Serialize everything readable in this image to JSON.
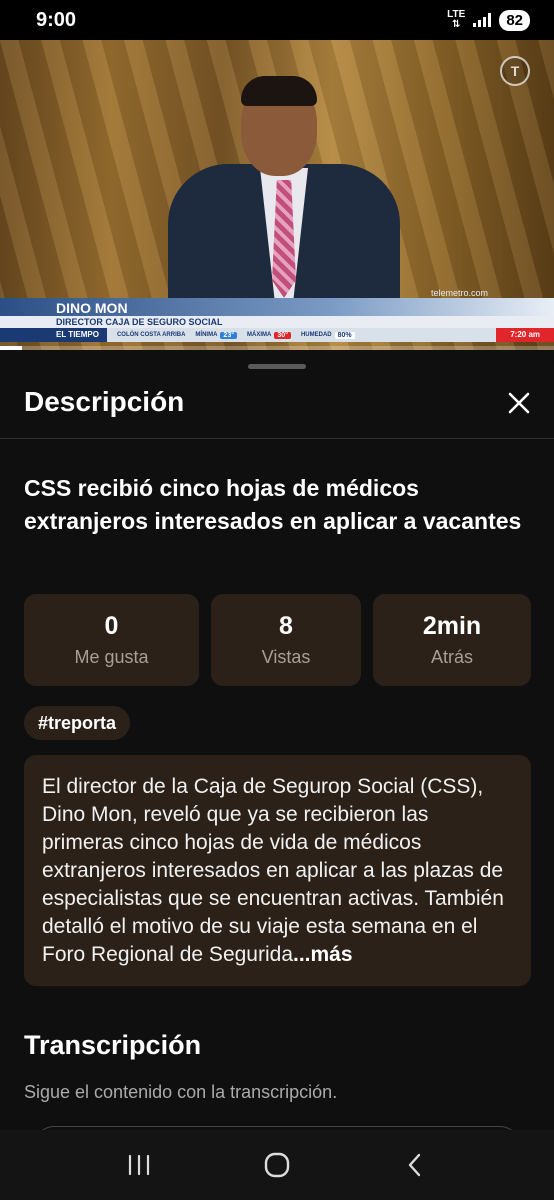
{
  "status_bar": {
    "time": "9:00",
    "network": "LTE",
    "battery": "82",
    "icons": [
      "lte-icon",
      "signal-icon",
      "battery-icon"
    ]
  },
  "video": {
    "channel_logo": "T",
    "watermark": "telemetro.com",
    "lower_third": {
      "name": "DINO MON",
      "title": "DIRECTOR CAJA DE SEGURO SOCIAL",
      "weather_label": "EL TIEMPO",
      "weather_location": "COLÓN COSTA ARRIBA",
      "minima_label": "MÍNIMA",
      "minima_value": "23°",
      "maxima_label": "MÁXIMA",
      "maxima_value": "30°",
      "humedad_label": "HUMEDAD",
      "humedad_value": "80%",
      "clock": "7:20 am"
    },
    "progress_fraction": 0.04
  },
  "sheet": {
    "title": "Descripción",
    "video_title": "CSS recibió cinco hojas de médicos extranjeros interesados en aplicar a vacantes",
    "stats": [
      {
        "value": "0",
        "label": "Me gusta"
      },
      {
        "value": "8",
        "label": "Vistas"
      },
      {
        "value": "2min",
        "label": "Atrás"
      }
    ],
    "hashtag": "#treporta",
    "description": "El director de la Caja de Segurop Social (CSS), Dino Mon, reveló que ya se recibieron las primeras cinco hojas de vida de médicos extranjeros interesados en aplicar a las plazas de especialistas que se encuentran activas. También detalló el motivo de su viaje esta semana en el Foro Regional de Segurida",
    "more_label": "...más",
    "transcript_title": "Transcripción",
    "transcript_subtitle": "Sigue el contenido con la transcripción."
  },
  "navbar": {
    "icons": [
      "recent-apps-icon",
      "home-icon",
      "back-icon"
    ]
  },
  "colors": {
    "background": "#0f0f0f",
    "card": "#2b2119",
    "muted_text": "#a99f95"
  }
}
